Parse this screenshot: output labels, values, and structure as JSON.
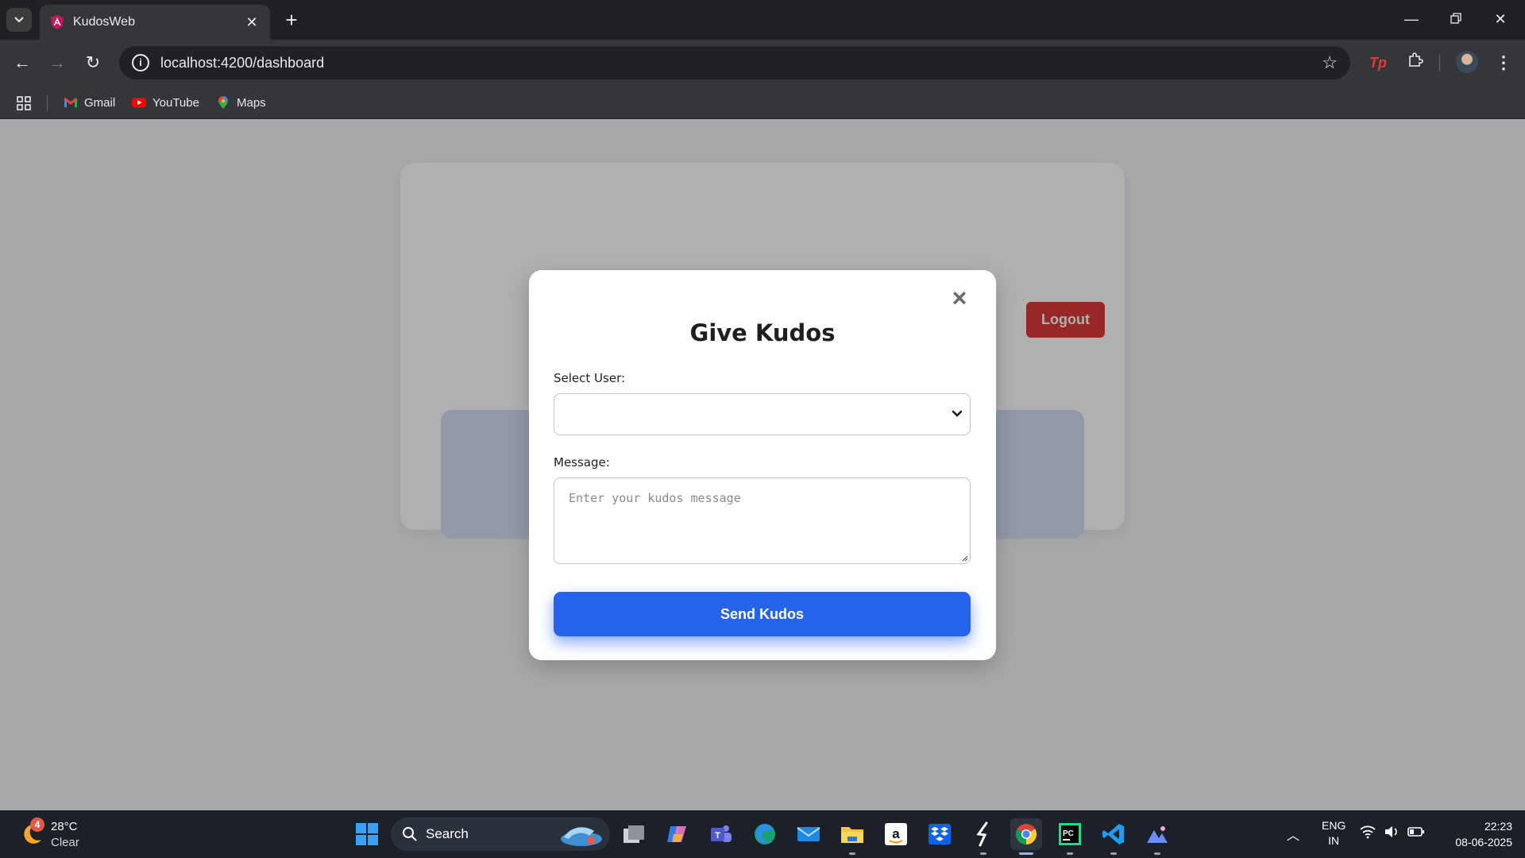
{
  "browser": {
    "tab": {
      "title": "KudosWeb"
    },
    "address_bar": {
      "url": "localhost:4200/dashboard"
    },
    "bookmarks": [
      {
        "label": "Gmail"
      },
      {
        "label": "YouTube"
      },
      {
        "label": "Maps"
      }
    ]
  },
  "dashboard": {
    "logout_label": "Logout"
  },
  "modal": {
    "title": "Give Kudos",
    "select_label": "Select User:",
    "select_value": "",
    "message_label": "Message:",
    "message_placeholder": "Enter your kudos message",
    "submit_label": "Send Kudos",
    "accent_color": "#2563eb"
  },
  "taskbar": {
    "weather": {
      "badge": "4",
      "temp": "28°C",
      "condition": "Clear"
    },
    "search_placeholder": "Search",
    "language": {
      "line1": "ENG",
      "line2": "IN"
    },
    "clock": {
      "time": "22:23",
      "date": "08-06-2025"
    }
  }
}
